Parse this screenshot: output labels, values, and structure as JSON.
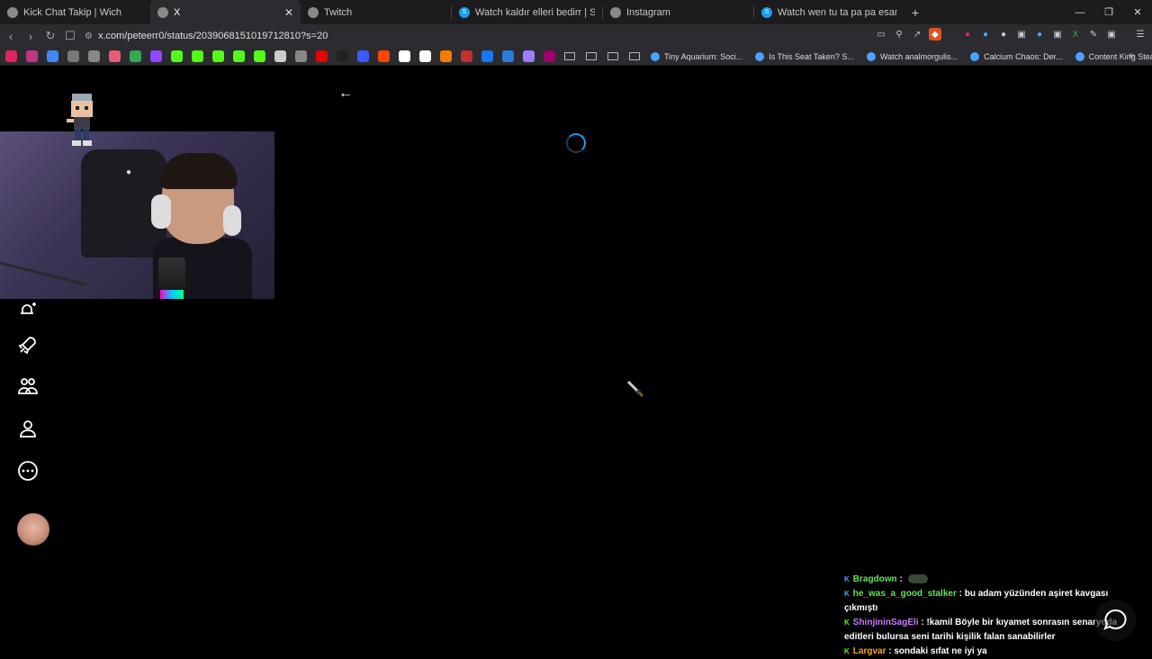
{
  "browser": {
    "tabs": [
      {
        "title": "Kick Chat Takip | Wich",
        "color": "#8a8a8a",
        "glyph": ""
      },
      {
        "title": "X",
        "color": "#8a8a8a",
        "glyph": "",
        "active": true
      },
      {
        "title": "Twitch",
        "color": "#8a8a8a",
        "glyph": ""
      },
      {
        "title": "Watch kaldır elleri bedirr | Streamable",
        "color": "#1d9bf0",
        "glyph": "S"
      },
      {
        "title": "Instagram",
        "color": "#8a8a8a",
        "glyph": ""
      },
      {
        "title": "Watch wen tu ta pa pa esannbanill v",
        "color": "#1d9bf0",
        "glyph": "S"
      }
    ],
    "url": "x.com/peteerr0/status/2039068151019712810?s=20",
    "bookmark_links": [
      "Tiny Aquarium: Soci...",
      "Is This Seat Taken? S...",
      "Watch analmorgulis...",
      "Calcium Chaos: Der...",
      "Content King Steam..."
    ],
    "bookmark_icon_colors": [
      "#e0245e",
      "#c13584",
      "#4285f4",
      "#777",
      "#888",
      "#e85d75",
      "#34a853",
      "#9146ff",
      "#53fc18",
      "#53fc18",
      "#53fc18",
      "#53fc18",
      "#53fc18",
      "#cccccc",
      "#888",
      "#e10600",
      "#222",
      "#3d5afe",
      "#ff4500",
      "#ffffff",
      "#ffffff",
      "#f57c00",
      "#c4302b",
      "#1877f2",
      "#2a7bde",
      "#9c7bff",
      "#a0006e"
    ]
  },
  "chat": {
    "messages": [
      {
        "user": "Bragdown",
        "user_color": "#62e35b",
        "text": "",
        "emote": true
      },
      {
        "user": "he_was_a_good_stalker",
        "user_color": "#62e35b",
        "text": "bu adam yüzünden aşiret kavgası çıkmıştı"
      },
      {
        "user": "ShinjininSagEli",
        "user_color": "#c77dff",
        "text": "!kamil Böyle bir kıyamet sonrasın senaryoda editleri bulursa seni tarihi kişilik falan sanabilirler"
      },
      {
        "user": "Largvar",
        "user_color": "#f5a623",
        "text": "sondaki sıfat ne iyi ya"
      }
    ]
  },
  "colors": {
    "accent": "#1d9bf0",
    "background": "#000000"
  }
}
